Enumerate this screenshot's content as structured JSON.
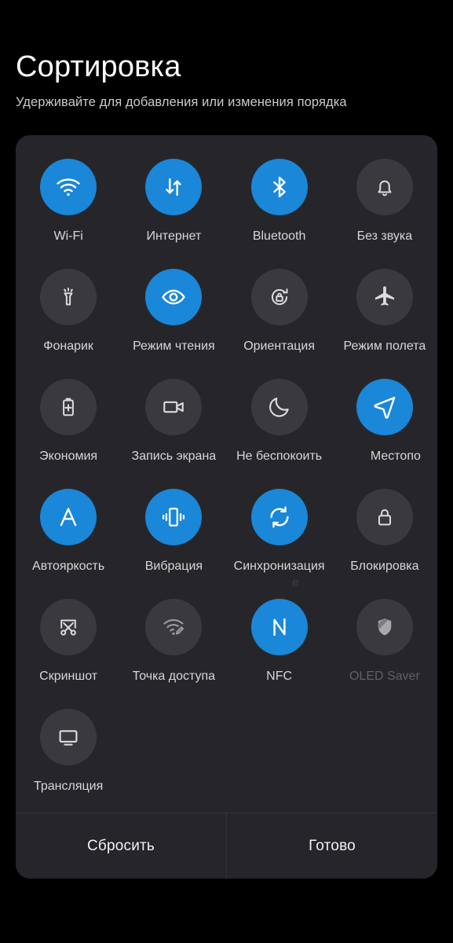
{
  "header": {
    "title": "Сортировка",
    "subtitle": "Удерживайте для добавления или изменения порядка"
  },
  "colors": {
    "background": "#000000",
    "card": "#26262a",
    "tile_active": "#1a87d8",
    "tile_inactive": "#3a3a3e",
    "label": "#d6d7d9",
    "label_disabled": "#5e6063",
    "divider": "#343438"
  },
  "overflow_label_fragment": "е",
  "tiles": [
    {
      "label": "Wi-Fi",
      "icon": "wifi-icon",
      "state": "on"
    },
    {
      "label": "Интернет",
      "icon": "data-transfer-icon",
      "state": "on"
    },
    {
      "label": "Bluetooth",
      "icon": "bluetooth-icon",
      "state": "on"
    },
    {
      "label": "Без звука",
      "icon": "bell-icon",
      "state": "off"
    },
    {
      "label": "Фонарик",
      "icon": "flashlight-icon",
      "state": "off"
    },
    {
      "label": "Режим чтения",
      "icon": "eye-icon",
      "state": "on"
    },
    {
      "label": "Ориентация",
      "icon": "rotation-lock-icon",
      "state": "off"
    },
    {
      "label": "Режим полета",
      "icon": "airplane-icon",
      "state": "off"
    },
    {
      "label": "Экономия",
      "icon": "battery-saver-icon",
      "state": "off"
    },
    {
      "label": "Запись экрана",
      "icon": "screen-record-icon",
      "state": "off"
    },
    {
      "label": "Не беспокоить",
      "icon": "moon-icon",
      "state": "off"
    },
    {
      "label": "Местопо",
      "icon": "location-arrow-icon",
      "state": "on"
    },
    {
      "label": "Автояркость",
      "icon": "auto-brightness-icon",
      "state": "on"
    },
    {
      "label": "Вибрация",
      "icon": "vibration-icon",
      "state": "on"
    },
    {
      "label": "Синхронизация",
      "icon": "sync-icon",
      "state": "on"
    },
    {
      "label": "Блокировка",
      "icon": "lock-icon",
      "state": "off"
    },
    {
      "label": "Скриншот",
      "icon": "screenshot-icon",
      "state": "off"
    },
    {
      "label": "Точка доступа",
      "icon": "hotspot-icon",
      "state": "off"
    },
    {
      "label": "NFC",
      "icon": "nfc-icon",
      "state": "on"
    },
    {
      "label": "OLED Saver",
      "icon": "shield-icon",
      "state": "disabled"
    },
    {
      "label": "Трансляция",
      "icon": "cast-icon",
      "state": "off"
    }
  ],
  "footer": {
    "reset_label": "Сбросить",
    "done_label": "Готово"
  }
}
